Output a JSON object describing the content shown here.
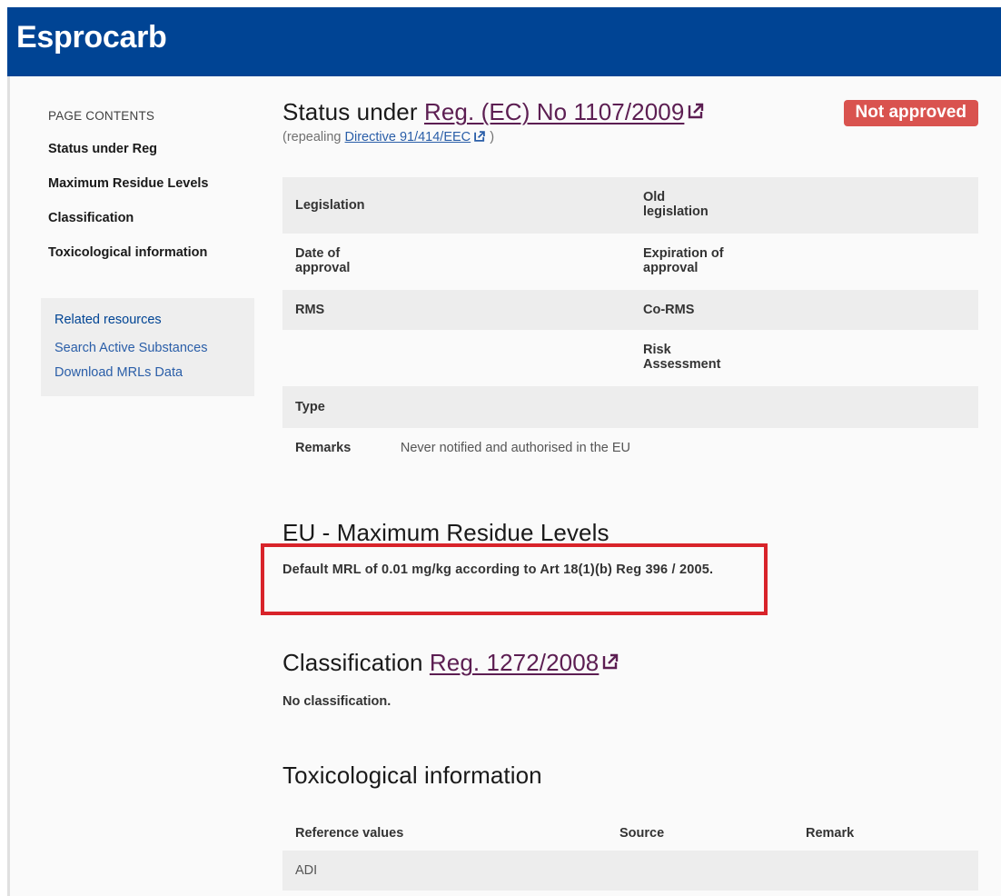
{
  "header": {
    "title": "Esprocarb"
  },
  "sidebar": {
    "heading": "PAGE CONTENTS",
    "items": [
      {
        "label": "Status under Reg"
      },
      {
        "label": "Maximum Residue Levels"
      },
      {
        "label": "Classification"
      },
      {
        "label": "Toxicological information"
      }
    ],
    "related": {
      "title": "Related resources",
      "links": [
        {
          "label": "Search Active Substances"
        },
        {
          "label": "Download MRLs Data"
        }
      ]
    }
  },
  "status": {
    "title_prefix": "Status under",
    "regulation_link": "Reg. (EC) No 1107/2009",
    "badge": "Not approved",
    "badge_color": "#d9534f",
    "repealing_prefix": "(repealing",
    "repealing_link": "Directive 91/414/EEC",
    "repealing_suffix": ")",
    "table": [
      {
        "label1": "Legislation",
        "value1": "",
        "label2": "Old legislation"
      },
      {
        "label1": "Date of approval",
        "value1": "",
        "label2": "Expiration of approval"
      },
      {
        "label1": "RMS",
        "value1": "",
        "label2": "Co-RMS"
      },
      {
        "label1": "",
        "value1": "",
        "label2": "Risk Assessment"
      },
      {
        "label1": "Type",
        "value1": "",
        "label2": ""
      },
      {
        "label1": "Remarks",
        "value1": "Never notified and authorised in the EU",
        "label2": ""
      }
    ]
  },
  "mrl": {
    "title": "EU - Maximum Residue Levels",
    "text": "Default MRL of 0.01 mg/kg according to Art 18(1)(b) Reg 396 / 2005."
  },
  "classification": {
    "title_prefix": "Classification",
    "regulation_link": "Reg. 1272/2008",
    "text": "No classification."
  },
  "toxicology": {
    "title": "Toxicological information",
    "columns": [
      "Reference values",
      "Source",
      "Remark"
    ],
    "rows": [
      {
        "reference": "ADI",
        "source": "",
        "remark": ""
      }
    ]
  },
  "colors": {
    "header_bg": "#004494",
    "link_purple": "#5c1e52",
    "link_blue": "#2a5ea8",
    "highlight_red": "#d8232a"
  },
  "icons": [
    "external-link-icon"
  ]
}
